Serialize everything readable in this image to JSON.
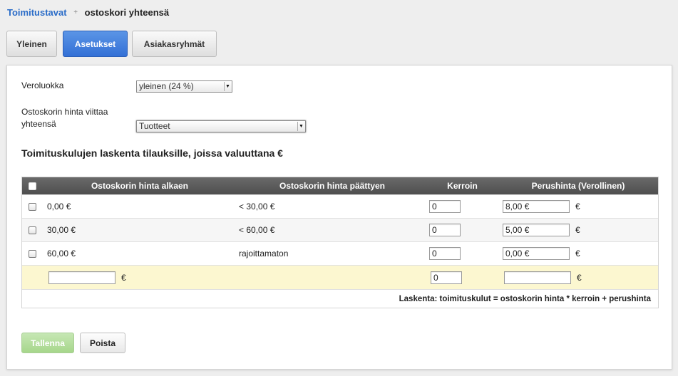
{
  "breadcrumb": {
    "parent": "Toimitustavat",
    "separator": "+",
    "current": "ostoskori yhteensä"
  },
  "tabs": [
    {
      "label": "Yleinen",
      "active": false
    },
    {
      "label": "Asetukset",
      "active": true
    },
    {
      "label": "Asiakasryhmät",
      "active": false
    }
  ],
  "form": {
    "tax_label": "Veroluokka",
    "tax_value": "yleinen (24 %)",
    "price_ref_label_1": "Ostoskorin hinta viittaa",
    "price_ref_label_2": "yhteensä",
    "price_ref_value": "Tuotteet"
  },
  "section_title": "Toimituskulujen laskenta tilauksille, joissa valuuttana €",
  "table": {
    "headers": {
      "from": "Ostoskorin hinta alkaen",
      "to": "Ostoskorin hinta päättyen",
      "multiplier": "Kerroin",
      "base_price": "Perushinta (Verollinen)"
    },
    "rows": [
      {
        "from": "0,00 €",
        "to": "< 30,00 €",
        "multiplier": "0",
        "base_price": "8,00 €",
        "currency": "€"
      },
      {
        "from": "30,00 €",
        "to": "< 60,00 €",
        "multiplier": "0",
        "base_price": "5,00 €",
        "currency": "€"
      },
      {
        "from": "60,00 €",
        "to": "rajoittamaton",
        "multiplier": "0",
        "base_price": "0,00 €",
        "currency": "€"
      }
    ],
    "new_row": {
      "from": "",
      "from_currency": "€",
      "multiplier": "0",
      "base_price": "",
      "base_currency": "€"
    },
    "formula": "Laskenta: toimituskulut = ostoskorin hinta * kerroin + perushinta"
  },
  "buttons": {
    "save": "Tallenna",
    "delete": "Poista"
  },
  "colors": {
    "accent": "#3370d6",
    "link": "#2a6cc8",
    "new_row_bg": "#fcf7d0",
    "save_button": "#a6d68b"
  }
}
